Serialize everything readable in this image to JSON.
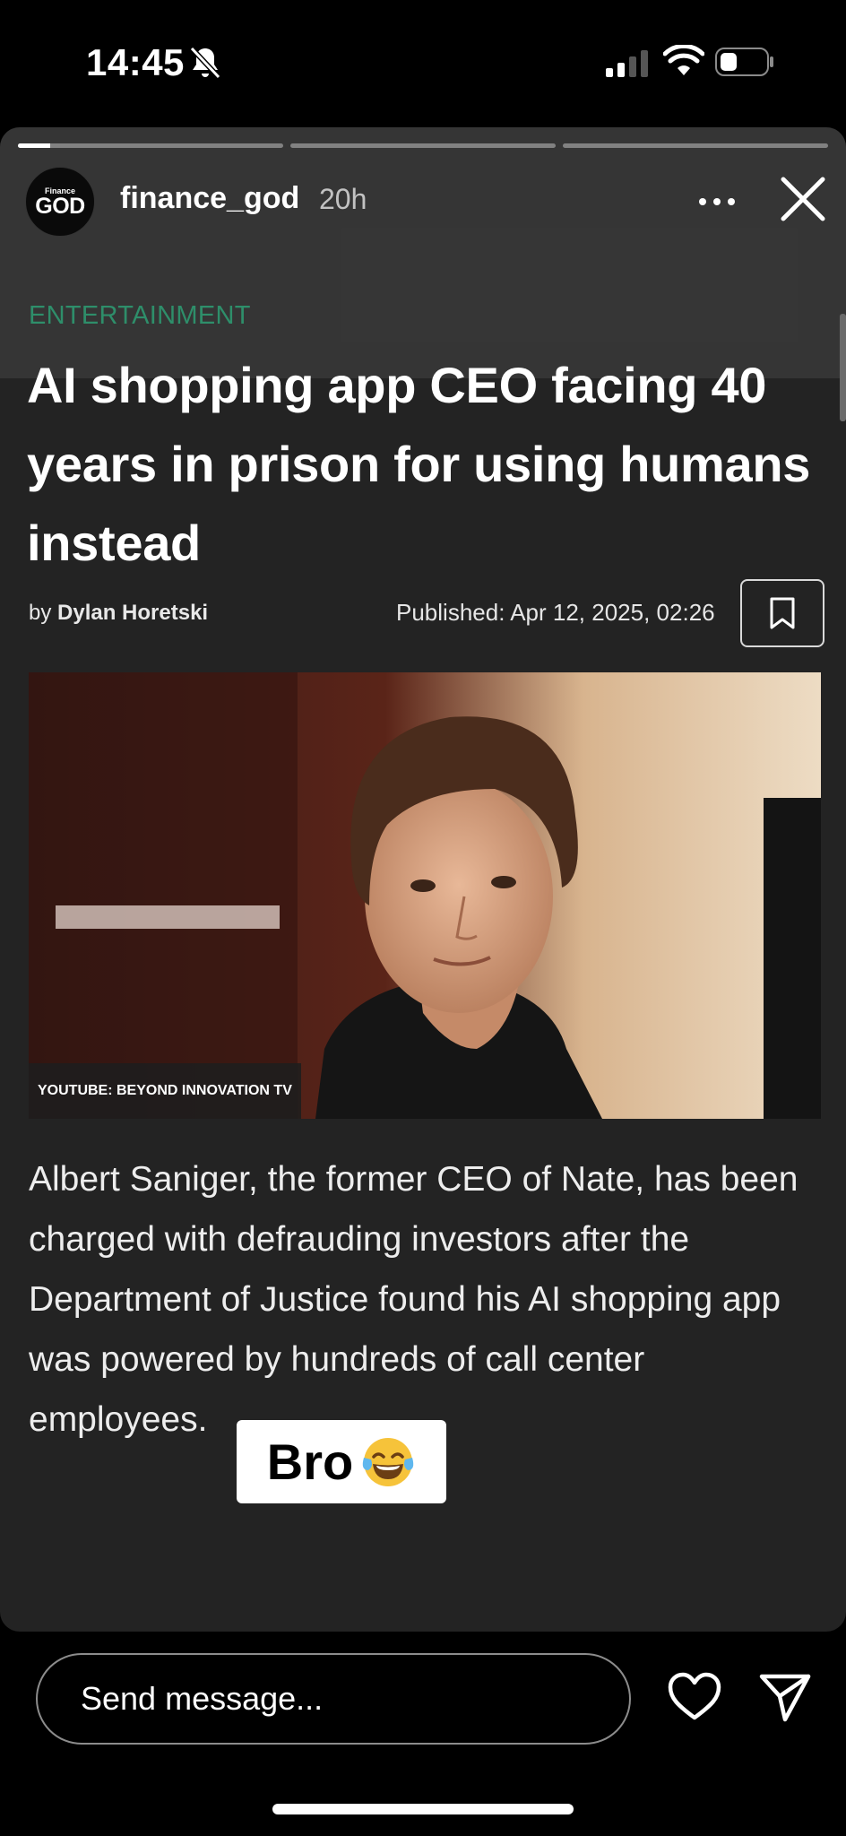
{
  "status_bar": {
    "time": "14:45",
    "icons": [
      "bell-slash-icon",
      "cellular-signal-icon",
      "wifi-icon",
      "battery-icon"
    ]
  },
  "story": {
    "progress": [
      0.12,
      0,
      0
    ],
    "account": {
      "avatar_small_text": "Finance",
      "avatar_big_text": "GOD",
      "username": "finance_god",
      "time_ago": "20h"
    },
    "icons": [
      "more-icon",
      "close-icon"
    ],
    "article": {
      "category": "ENTERTAINMENT",
      "headline": "AI shopping app CEO facing 40 years in prison for using humans instead",
      "byline_prefix": "by",
      "author": "Dylan Horetski",
      "published": "Published: Apr 12, 2025, 02:26",
      "photo_caption": "YOUTUBE: BEYOND INNOVATION TV",
      "body": "Albert Saniger, the former CEO of Nate, has been charged with defrauding investors after the Department of Justice found his AI shopping app was powered by hundreds of call center employees."
    },
    "sticker": {
      "text": "Bro",
      "emoji": "tears-of-joy-emoji"
    }
  },
  "reply_bar": {
    "placeholder": "Send message...",
    "icons": [
      "heart-icon",
      "send-icon"
    ]
  },
  "colors": {
    "accent_category": "#2e8e6a",
    "story_background": "#232323",
    "page_background": "#000000"
  }
}
